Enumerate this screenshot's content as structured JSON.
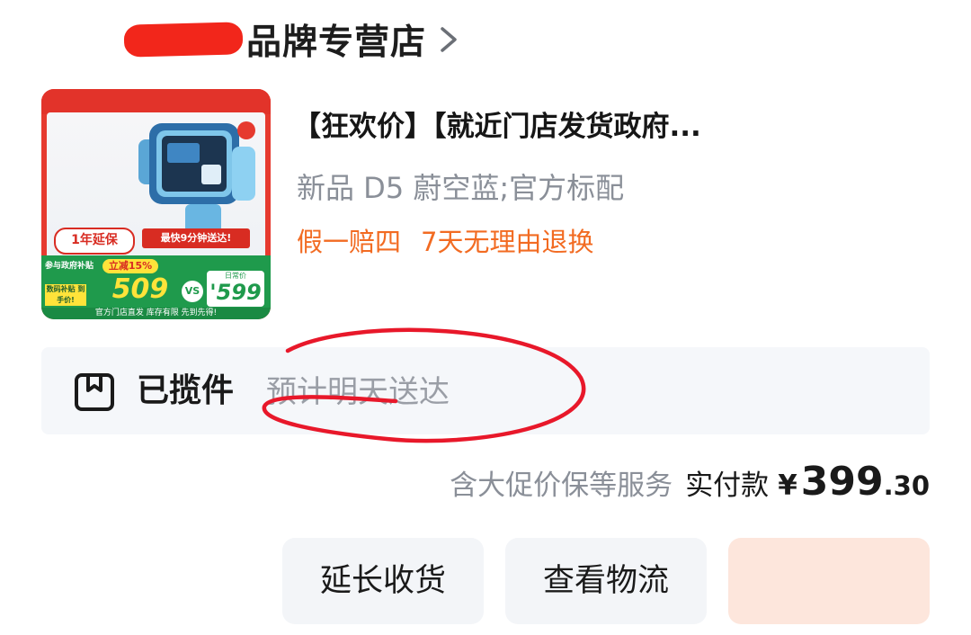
{
  "shop": {
    "name": "品牌专营店"
  },
  "product": {
    "title": "【狂欢价】【就近门店发货政府...",
    "variant": "新品 D5  蔚空蓝;官方标配",
    "guarantees": [
      "假一赔四",
      "7天无理由退换"
    ]
  },
  "thumbnail": {
    "warranty": "1年延保",
    "fast_delivery": "最快9分钟送达!",
    "promo_label": "参与政府补贴",
    "promo_sub": "数码补贴 到手价!",
    "save_tag": "立减15%",
    "price_now": "509",
    "vs": "VS",
    "price_daily_label": "日常价",
    "price_daily": "'599",
    "footer": "官方门店直发 库存有限 先到先得!"
  },
  "logistics": {
    "status": "已揽件",
    "eta": "预计明天送达"
  },
  "payment": {
    "services": "含大促价保等服务",
    "label": "实付款",
    "currency": "¥",
    "amount_int": "399",
    "amount_dec": ".30"
  },
  "actions": {
    "extend": "延长收货",
    "track": "查看物流",
    "confirm": ""
  },
  "colors": {
    "accent_orange": "#f26b22",
    "annotation_red": "#e8182a",
    "redaction_red": "#f2261b"
  }
}
